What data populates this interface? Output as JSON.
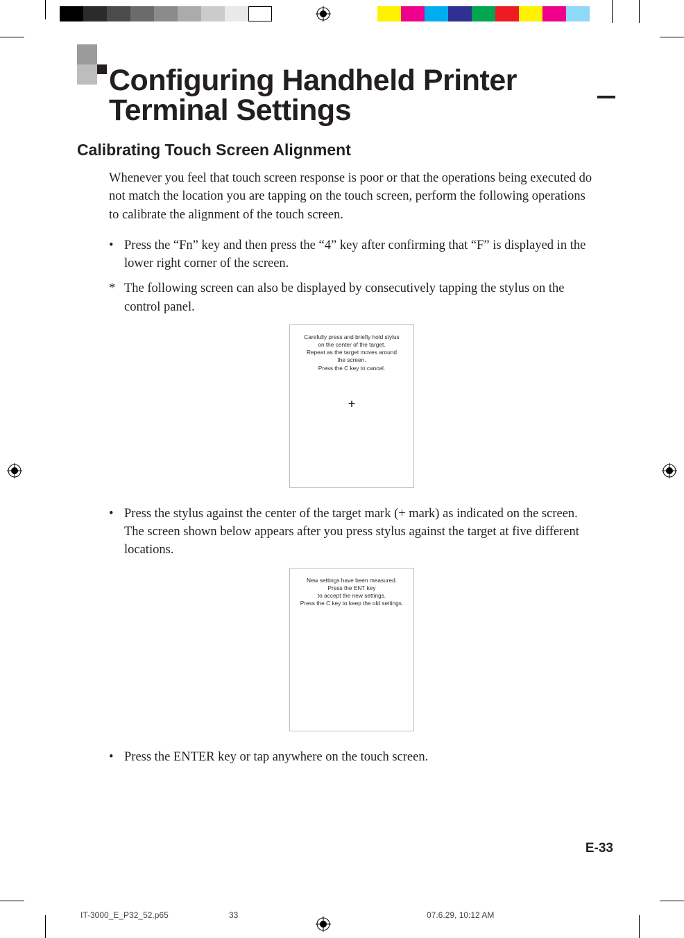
{
  "title": "Configuring Handheld Printer Terminal Settings",
  "section": "Calibrating Touch Screen Alignment",
  "intro": "Whenever you feel that touch screen response is poor or that the operations being executed do not match the location you are tapping on the touch screen, perform the following operations to calibrate the alignment of the touch screen.",
  "bullets": {
    "b1": "Press the “Fn” key and then press the “4” key after confirming that “F” is displayed in the lower right corner of the screen.",
    "b1_note": "The following screen can also be displayed by consecutively tapping the stylus on the control panel.",
    "b2": "Press the stylus against the center of the target mark (+ mark) as indicated on the screen. The screen shown below appears after you press stylus against the target at five different locations.",
    "b3": "Press the ENTER key or tap anywhere on the touch screen."
  },
  "screen1": {
    "l1": "Carefully press and briefly hold stylus",
    "l2": "on the center of the target.",
    "l3": "Repeat as the target moves around",
    "l4": "the screen.",
    "l5": "Press the C key to cancel."
  },
  "screen2": {
    "l1": "New settings have been measured.",
    "l2": "Press the ENT key",
    "l3": "to accept the new settings.",
    "l4": "Press the C key to keep the old settings."
  },
  "page_number": "E-33",
  "footer": {
    "file": "IT-3000_E_P32_52.p65",
    "pg": "33",
    "date": "07.6.29, 10:12 AM"
  },
  "glyphs": {
    "dot": "•",
    "ast": "*",
    "plus": "+"
  },
  "print_marks": {
    "gray_swatches": [
      "#000000",
      "#2b2b2b",
      "#4b4b4b",
      "#6b6b6b",
      "#8b8b8b",
      "#ababab",
      "#cbcbcb",
      "#ffffff"
    ],
    "color_swatches": [
      "#fff200",
      "#ec008c",
      "#00aeef",
      "#2e3192",
      "#00a651",
      "#ed1c24",
      "#fff200",
      "#ec008c",
      "#00aeef"
    ]
  }
}
